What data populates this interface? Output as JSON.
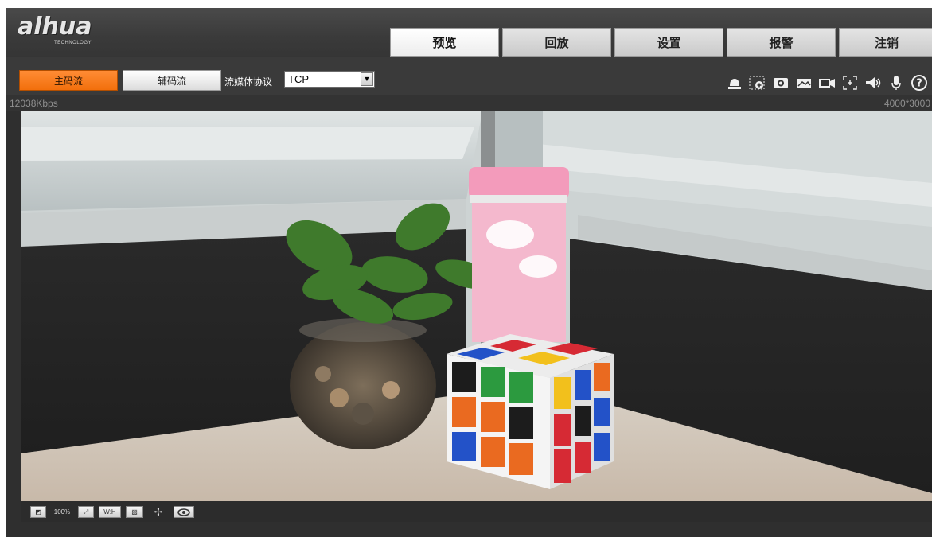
{
  "brand": {
    "logo_text": "alhua",
    "logo_tagline": "TECHNOLOGY"
  },
  "nav": {
    "tabs": [
      {
        "label": "预览",
        "active": true
      },
      {
        "label": "回放",
        "active": false
      },
      {
        "label": "设置",
        "active": false
      },
      {
        "label": "报警",
        "active": false
      },
      {
        "label": "注销",
        "active": false
      }
    ]
  },
  "toolbar": {
    "main_stream_label": "主码流",
    "sub_stream_label": "辅码流",
    "protocol_label": "流媒体协议",
    "protocol_value": "TCP",
    "icons": [
      "alarm-bell-icon",
      "zoom-in-icon",
      "snapshot-icon",
      "triple-snapshot-icon",
      "record-icon",
      "digital-zoom-icon",
      "audio-icon",
      "microphone-icon",
      "help-icon"
    ]
  },
  "status": {
    "bitrate": "12038Kbps",
    "resolution": "4000*3000"
  },
  "bottom_controls": {
    "zoom_label": "100%",
    "wh_label": "W:H",
    "icons": [
      "image-adjust-icon",
      "original-size-icon",
      "fullscreen-icon",
      "aspect-ratio-icon",
      "fluency-icon",
      "ptz-icon",
      "eye-icon"
    ]
  },
  "colors": {
    "accent_orange": "#f26f0c",
    "header_bg": "#3a3a3a",
    "frame_bg": "#2f2f2f"
  }
}
